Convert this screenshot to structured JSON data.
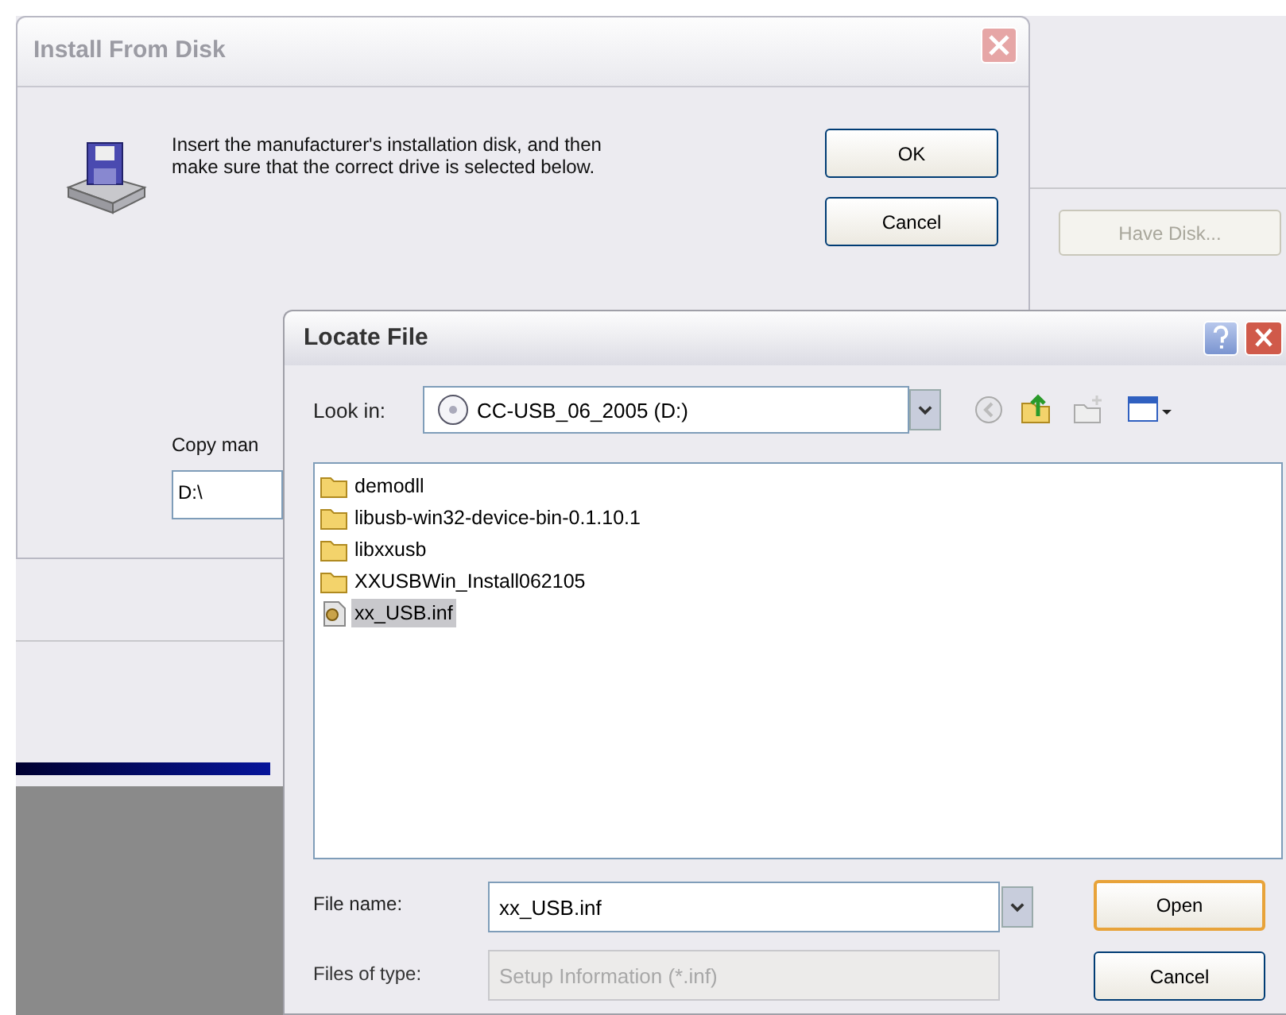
{
  "install_dialog": {
    "title": "Install From Disk",
    "message": "Insert the manufacturer's installation disk, and then make sure that the correct drive is selected below.",
    "buttons": [
      {
        "label": "OK"
      },
      {
        "label": "Cancel"
      }
    ],
    "copy_label": "Copy man",
    "path_value": "D:\\"
  },
  "have_disk_button": {
    "label": "Have Disk...",
    "disabled": true
  },
  "locate_dialog": {
    "title": "Locate File",
    "look_in_label": "Look in:",
    "look_in_value": "CC-USB_06_2005 (D:)",
    "items": [
      {
        "name": "demodll",
        "kind": "folder",
        "selected": false
      },
      {
        "name": "libusb-win32-device-bin-0.1.10.1",
        "kind": "folder",
        "selected": false
      },
      {
        "name": "libxxusb",
        "kind": "folder",
        "selected": false
      },
      {
        "name": "XXUSBWin_Install062105",
        "kind": "folder",
        "selected": false
      },
      {
        "name": "xx_USB.inf",
        "kind": "file",
        "selected": true
      }
    ],
    "file_name_label": "File name:",
    "file_name_value": "xx_USB.inf",
    "file_type_label": "Files of type:",
    "file_type_value": "Setup Information (*.inf)",
    "file_type_disabled": true,
    "buttons": [
      {
        "label": "Open",
        "default": true
      },
      {
        "label": "Cancel",
        "default": false
      }
    ]
  }
}
